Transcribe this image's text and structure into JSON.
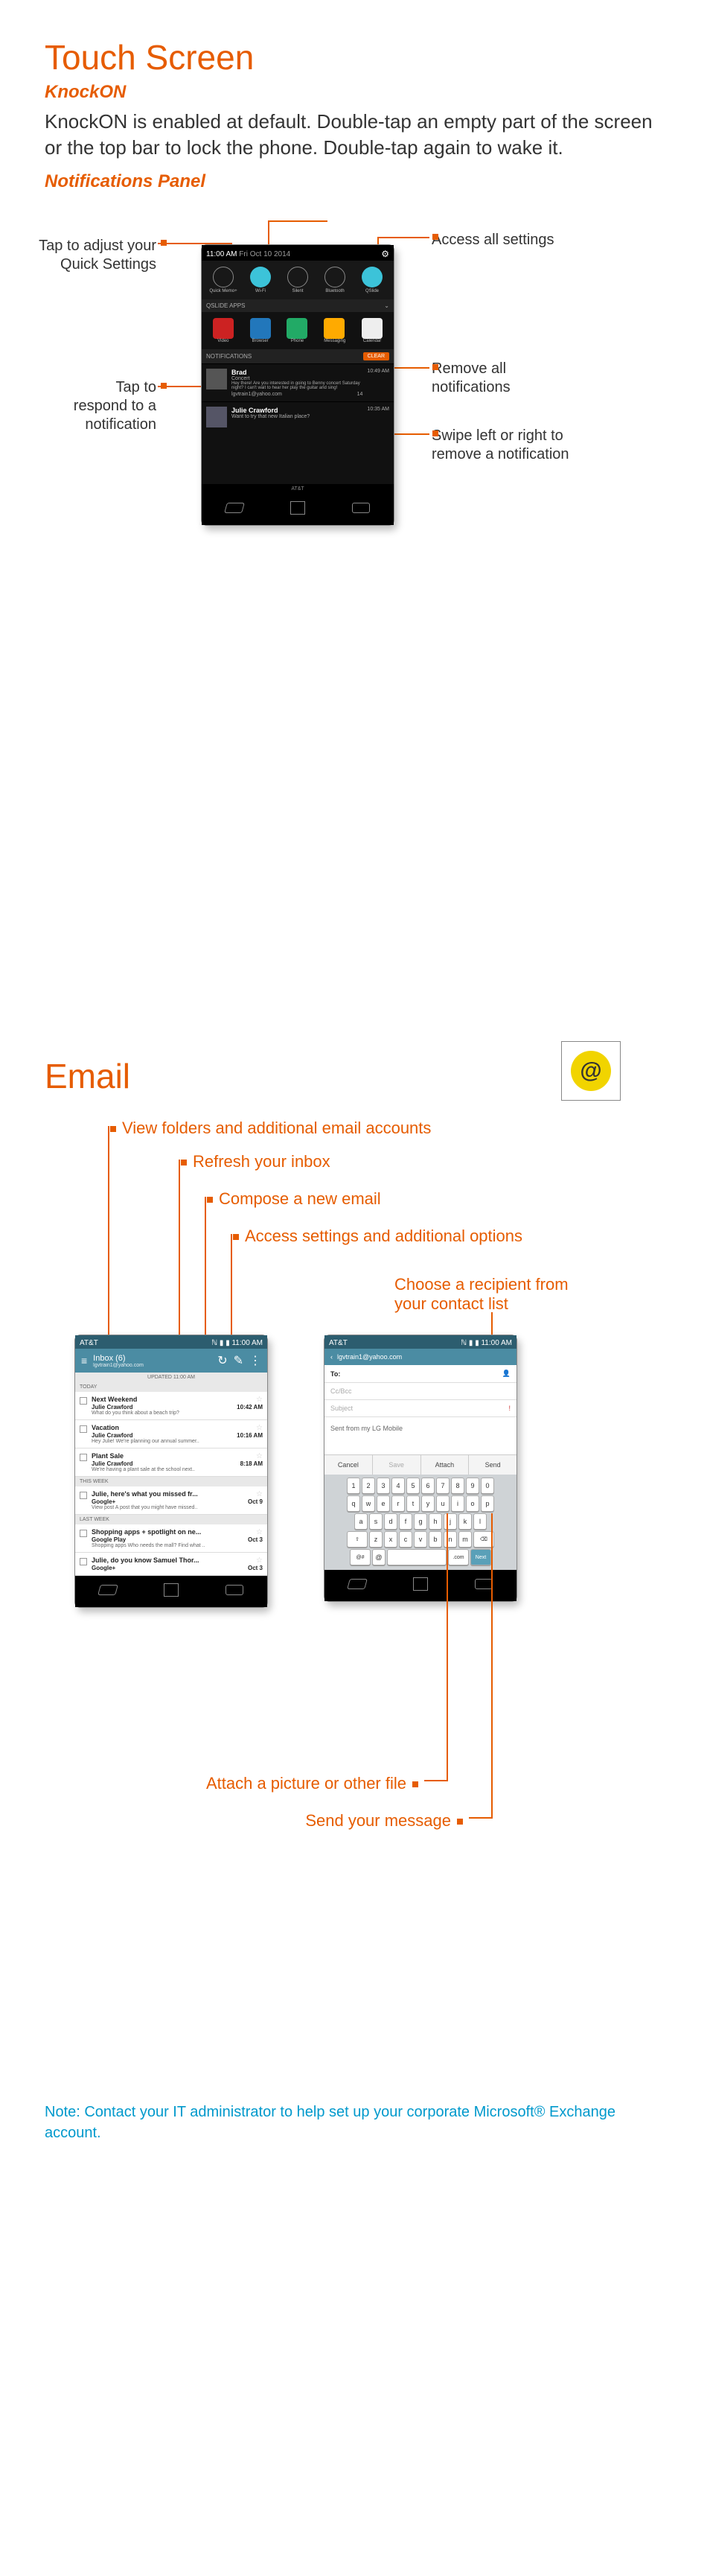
{
  "touch": {
    "title": "Touch Screen",
    "knockon_heading": "KnockON",
    "knockon_body": "KnockON is enabled at default. Double-tap an empty part of the screen or the top bar to lock the phone. Double-tap again to wake it.",
    "notif_heading": "Notifications Panel",
    "callouts": {
      "quick_settings": "Tap to adjust your Quick Settings",
      "access_settings": "Access all settings",
      "remove_all": "Remove all notifications",
      "respond": "Tap to respond to a notification",
      "swipe": "Swipe left or right to remove a notification"
    },
    "phone": {
      "time": "11:00 AM",
      "date": "Fri Oct 10 2014",
      "qs": [
        "Quick Memo+",
        "Wi-Fi",
        "Silent",
        "Bluetooth",
        "QSlide"
      ],
      "apps_hdr": "QSLIDE APPS",
      "apps": [
        "Video",
        "Browser",
        "Phone",
        "Messaging",
        "Calendar"
      ],
      "notif_hdr": "NOTIFICATIONS",
      "clear": "CLEAR",
      "brand": "AT&T",
      "n1": {
        "from": "Brad",
        "subj": "Concert",
        "body": "Hey there! Are you interested in going to Benny concert Saturday night? I can't wait to hear her play the guitar and sing!",
        "acct": "lgvtrain1@yahoo.com",
        "time": "10:49 AM",
        "count": "14"
      },
      "n2": {
        "from": "Julie Crawford",
        "body": "Want to try that new Italian place?",
        "time": "10:35 AM"
      }
    }
  },
  "email": {
    "title": "Email",
    "callouts": {
      "folders": "View folders and additional email accounts",
      "refresh": "Refresh your inbox",
      "compose": "Compose a new email",
      "options": "Access settings and additional options",
      "recipient": "Choose a recipient from your contact list",
      "attach": "Attach a picture or other file",
      "send": "Send your message"
    },
    "list_phone": {
      "carrier": "AT&T",
      "time": "11:00 AM",
      "inbox": "Inbox  (6)",
      "acct": "lgvtrain1@yahoo.com",
      "updated": "UPDATED 11:00 AM",
      "sec_today": "TODAY",
      "sec_week": "THIS WEEK",
      "sec_last": "LAST WEEK",
      "items": [
        {
          "title": "Next Weekend",
          "from": "Julie Crawford",
          "time": "10:42 AM",
          "prev": "What do you think about a beach trip?"
        },
        {
          "title": "Vacation",
          "from": "Julie Crawford",
          "time": "10:16 AM",
          "prev": "Hey Julie! We're planning our annual summer.."
        },
        {
          "title": "Plant Sale",
          "from": "Julie Crawford",
          "time": "8:18 AM",
          "prev": "We're having a plant sale at the school next.."
        },
        {
          "title": "Julie, here's what you missed fr...",
          "from": "Google+",
          "time": "Oct 9",
          "prev": "View post A post that you might have missed.."
        },
        {
          "title": "Shopping apps + spotlight on ne...",
          "from": "Google Play",
          "time": "Oct 3",
          "prev": "Shopping apps Who needs the mall? Find what .."
        },
        {
          "title": "Julie, do you know Samuel Thor...",
          "from": "Google+",
          "time": "Oct 3",
          "prev": ""
        }
      ]
    },
    "compose_phone": {
      "carrier": "AT&T",
      "time": "11:00 AM",
      "acct": "lgvtrain1@yahoo.com",
      "to_label": "To:",
      "cc": "Cc/Bcc",
      "subject": "Subject",
      "body": "Sent from my LG Mobile",
      "cancel": "Cancel",
      "save": "Save",
      "attach": "Attach",
      "send": "Send",
      "kbd_done": ".com",
      "kbd_next": "Next"
    },
    "note": "Note: Contact your IT administrator to help set up your corporate Microsoft® Exchange account."
  }
}
